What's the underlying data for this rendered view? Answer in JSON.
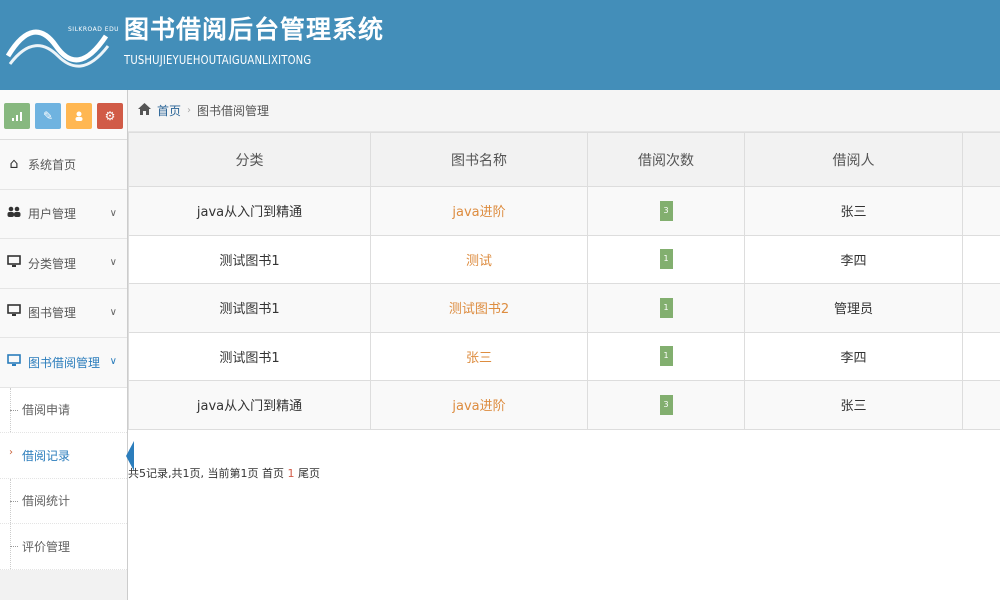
{
  "header": {
    "logo_text": "SILKROAD EDU",
    "title_cn": "图书借阅后台管理系统",
    "title_en": "TUSHUJIEYUEHOUTAIGUANLIXITONG"
  },
  "shortcuts": [
    {
      "icon": "signal-icon",
      "glyph": "▐",
      "color": "#87b87f"
    },
    {
      "icon": "pencil-icon",
      "glyph": "✎",
      "color": "#6fb3e0"
    },
    {
      "icon": "users-icon",
      "glyph": "♟",
      "color": "#ffb752"
    },
    {
      "icon": "cogs-icon",
      "glyph": "⚙",
      "color": "#d15b47"
    }
  ],
  "sidebar": {
    "items": [
      {
        "label": "系统首页",
        "icon": "home-icon"
      },
      {
        "label": "用户管理",
        "icon": "users-icon"
      },
      {
        "label": "分类管理",
        "icon": "desktop-icon"
      },
      {
        "label": "图书管理",
        "icon": "desktop-icon"
      },
      {
        "label": "图书借阅管理",
        "icon": "desktop-icon"
      }
    ],
    "sub_items": [
      {
        "label": "借阅申请"
      },
      {
        "label": "借阅记录"
      },
      {
        "label": "借阅统计"
      },
      {
        "label": "评价管理"
      }
    ]
  },
  "breadcrumb": {
    "home": "首页",
    "current": "图书借阅管理"
  },
  "table": {
    "headers": [
      "分类",
      "图书名称",
      "借阅次数",
      "借阅人",
      ""
    ],
    "rows": [
      {
        "category": "java从入门到精通",
        "book": "java进阶",
        "count": "3",
        "borrower": "张三"
      },
      {
        "category": "测试图书1",
        "book": "测试",
        "count": "1",
        "borrower": "李四"
      },
      {
        "category": "测试图书1",
        "book": "测试图书2",
        "count": "1",
        "borrower": "管理员"
      },
      {
        "category": "测试图书1",
        "book": "张三",
        "count": "1",
        "borrower": "李四"
      },
      {
        "category": "java从入门到精通",
        "book": "java进阶",
        "count": "3",
        "borrower": "张三"
      }
    ]
  },
  "pager": {
    "summary": "共5记录,共1页, 当前第1页 首页 ",
    "current": "1",
    "last": " 尾页"
  },
  "colors": {
    "header_bg": "#438eb9",
    "book_link": "#dd8c3f",
    "badge": "#82af6f",
    "active": "#2b7dbc"
  }
}
